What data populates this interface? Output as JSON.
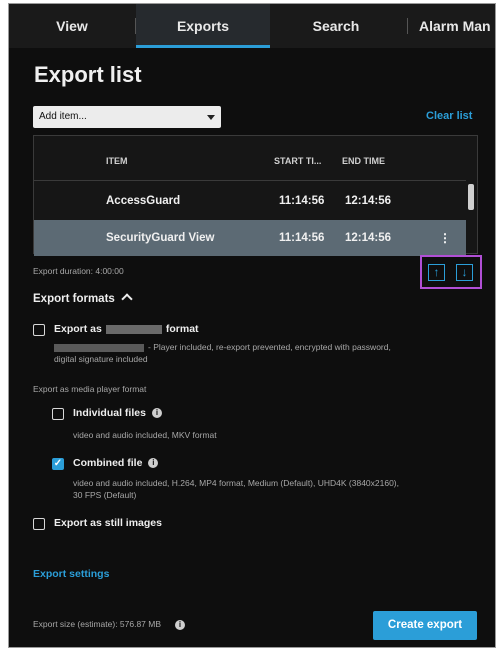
{
  "tabs": [
    {
      "label": "View"
    },
    {
      "label": "Exports",
      "active": true
    },
    {
      "label": "Search"
    },
    {
      "label": "Alarm Man"
    }
  ],
  "page_title": "Export list",
  "add_item": {
    "value": "Add item..."
  },
  "clear_list": "Clear list",
  "table": {
    "columns": [
      "ITEM",
      "START TI...",
      "END TIME"
    ],
    "rows": [
      {
        "item": "AccessGuard",
        "start": "11:14:56",
        "end": "12:14:56",
        "selected": false
      },
      {
        "item": "SecurityGuard View",
        "start": "11:14:56",
        "end": "12:14:56",
        "selected": true
      }
    ]
  },
  "export_duration": "Export duration: 4:00:00",
  "export_formats": {
    "title": "Export formats",
    "format_option": {
      "label_prefix": "Export as",
      "label_suffix": "format",
      "desc_line1": "- Player included, re-export prevented, encrypted with password,",
      "desc_line2": "digital signature included",
      "checked": false
    },
    "media_player_heading": "Export as media player format",
    "individual_files": {
      "label": "Individual files",
      "desc": "video and audio included, MKV format",
      "checked": false
    },
    "combined_file": {
      "label": "Combined file",
      "desc_line1": "video and audio included, H.264, MP4 format, Medium (Default), UHD4K (3840x2160),",
      "desc_line2": "30 FPS (Default)",
      "checked": true
    },
    "still_images": {
      "label": "Export as still images",
      "checked": false
    }
  },
  "export_settings": "Export settings",
  "export_size": "Export size (estimate): 576.87 MB",
  "create_export": "Create export",
  "colors": {
    "accent": "#2b9ed8",
    "highlight": "#b14fd6",
    "selected_row": "#5c6a74",
    "background": "#0e0e0e"
  }
}
